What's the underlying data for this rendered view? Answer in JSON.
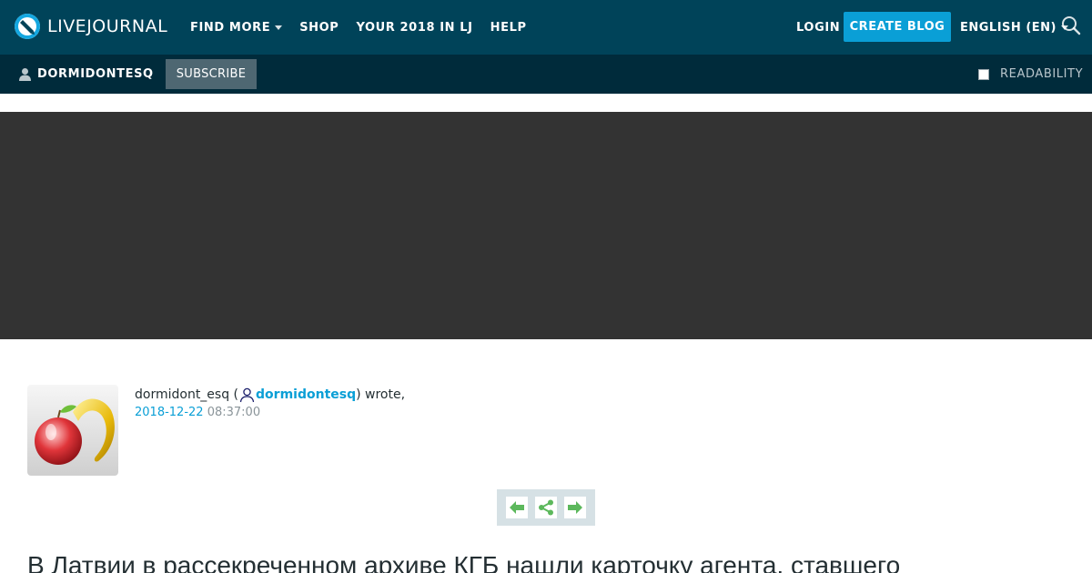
{
  "header": {
    "logo_text": "LIVEJOURNAL",
    "nav": [
      {
        "label": "FIND MORE",
        "has_dropdown": true
      },
      {
        "label": "SHOP",
        "has_dropdown": false
      },
      {
        "label": "YOUR 2018 IN LJ",
        "has_dropdown": false
      },
      {
        "label": "HELP",
        "has_dropdown": false
      }
    ],
    "login_label": "LOGIN",
    "create_blog_label": "CREATE BLOG",
    "language_label": "ENGLISH (EN)",
    "search_icon": "search-icon"
  },
  "subbar": {
    "journal_username": "DORMIDONTESQ",
    "subscribe_label": "SUBSCRIBE",
    "readability_label": "READABILITY",
    "readability_checked": false
  },
  "entry": {
    "poster_name": "dormidont_esq",
    "open_paren": " (",
    "poster_user_link": "dormidontesq",
    "wrote_text": ") wrote,",
    "date": "2018-12-22",
    "time": "08:37:00",
    "title": "В Латвии в рассекреченном архиве КГБ нашли карточку агента, ставшего"
  },
  "colors": {
    "header_bg": "#004359",
    "subbar_bg": "#002b3b",
    "accent": "#0a9fd6",
    "banner_bg": "#333333",
    "entry_nav_bg": "#d6e1e5",
    "arrow_green": "#5cb85c"
  }
}
